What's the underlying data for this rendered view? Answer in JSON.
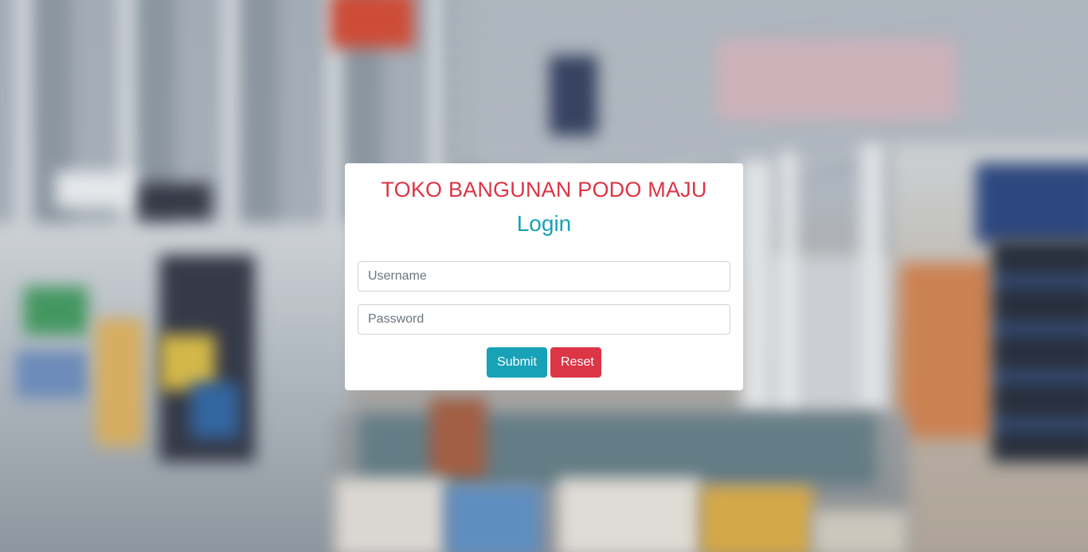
{
  "store_name": "TOKO BANGUNAN PODO MAJU",
  "form": {
    "title": "Login",
    "username": {
      "value": "",
      "placeholder": "Username"
    },
    "password": {
      "value": "",
      "placeholder": "Password"
    },
    "submit_label": "Submit",
    "reset_label": "Reset"
  },
  "colors": {
    "title_red": "#dc3545",
    "login_teal": "#17a2b8",
    "submit_bg": "#17a2b8",
    "reset_bg": "#dc3545"
  }
}
